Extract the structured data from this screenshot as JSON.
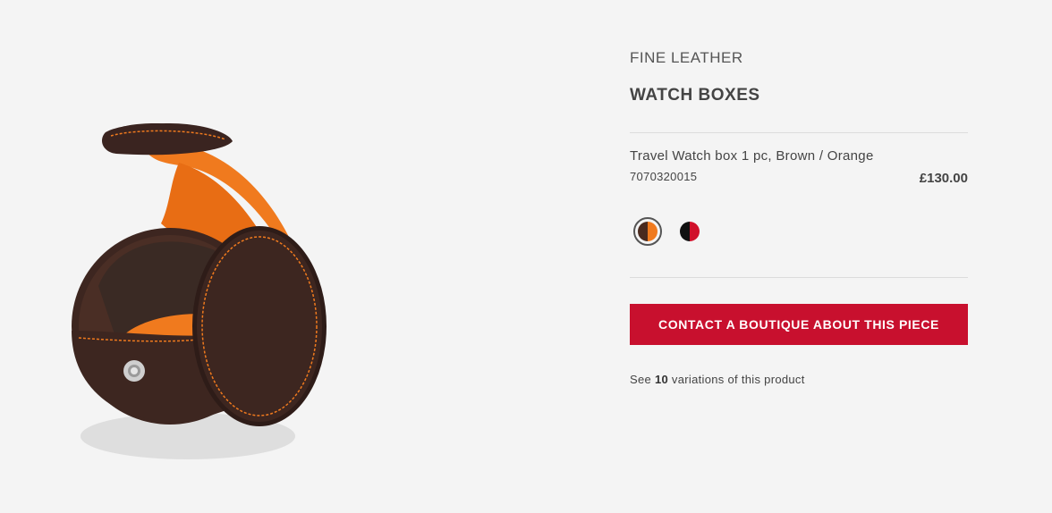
{
  "product": {
    "category": "FINE LEATHER",
    "subcategory": "WATCH BOXES",
    "name": "Travel Watch box 1 pc, Brown / Orange",
    "reference": "7070320015",
    "price": "£130.00"
  },
  "swatches": [
    {
      "name": "Brown / Orange",
      "left_color": "#4a2a1e",
      "right_color": "#f07a1e",
      "selected": true
    },
    {
      "name": "Black / Red",
      "left_color": "#111111",
      "right_color": "#d0102a",
      "selected": false
    }
  ],
  "cta": {
    "label": "CONTACT A BOUTIQUE ABOUT THIS PIECE",
    "color": "#c8102e"
  },
  "variations": {
    "prefix": "See ",
    "count": "10",
    "suffix": " variations of this product"
  },
  "image": {
    "alt": "Travel watch box in brown leather with orange interior",
    "body_color": "#3d2620",
    "interior_color": "#f07a1e"
  }
}
